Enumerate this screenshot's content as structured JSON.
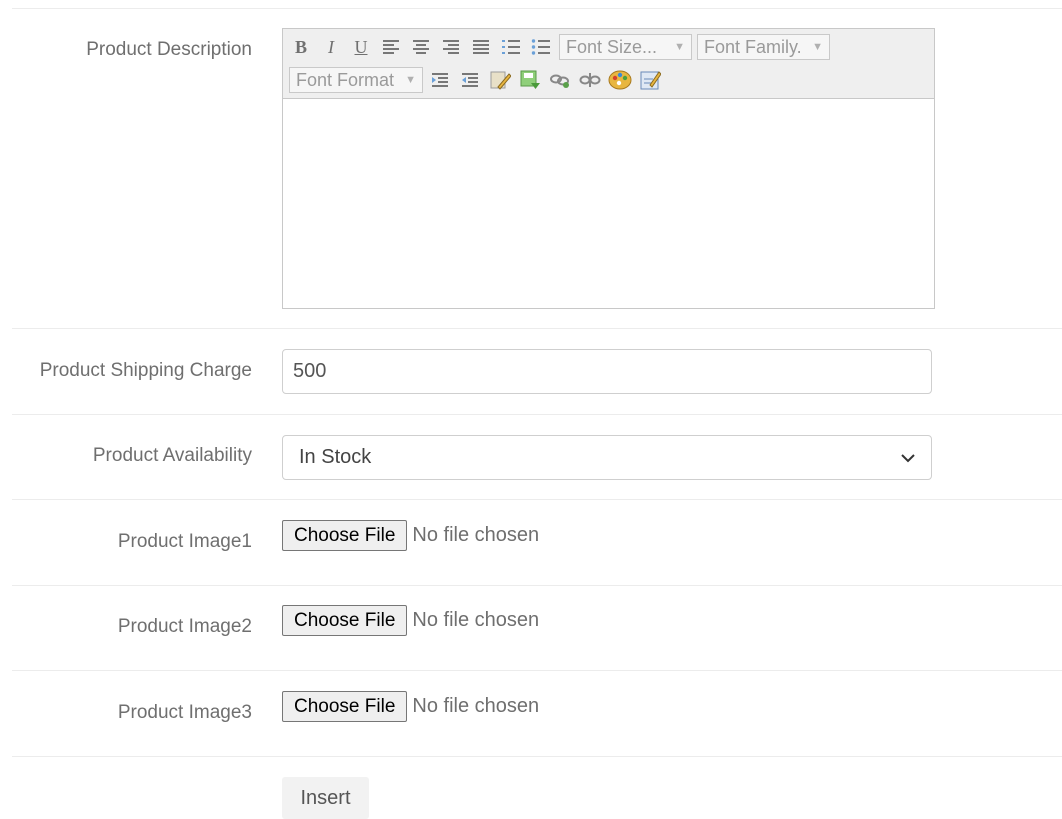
{
  "fields": {
    "description": {
      "label": "Product Description"
    },
    "shipping": {
      "label": "Product Shipping Charge",
      "value": "500"
    },
    "availability": {
      "label": "Product Availability",
      "selected": "In Stock"
    },
    "image1": {
      "label": "Product Image1",
      "button": "Choose File",
      "status": "No file chosen"
    },
    "image2": {
      "label": "Product Image2",
      "button": "Choose File",
      "status": "No file chosen"
    },
    "image3": {
      "label": "Product Image3",
      "button": "Choose File",
      "status": "No file chosen"
    }
  },
  "editor": {
    "font_size_label": "Font Size...",
    "font_family_label": "Font Family.",
    "font_format_label": "Font Format",
    "toolbar_icons": [
      "bold-icon",
      "italic-icon",
      "underline-icon",
      "align-left-icon",
      "align-center-icon",
      "align-right-icon",
      "align-justify-icon",
      "ordered-list-icon",
      "unordered-list-icon",
      "outdent-icon",
      "indent-icon",
      "insert-image-icon",
      "save-icon",
      "link-icon",
      "unlink-icon",
      "color-icon",
      "edit-html-icon"
    ],
    "colors": {
      "toolbar_bg": "#efefef",
      "border": "#c8c8c8"
    }
  },
  "actions": {
    "insert_label": "Insert"
  }
}
